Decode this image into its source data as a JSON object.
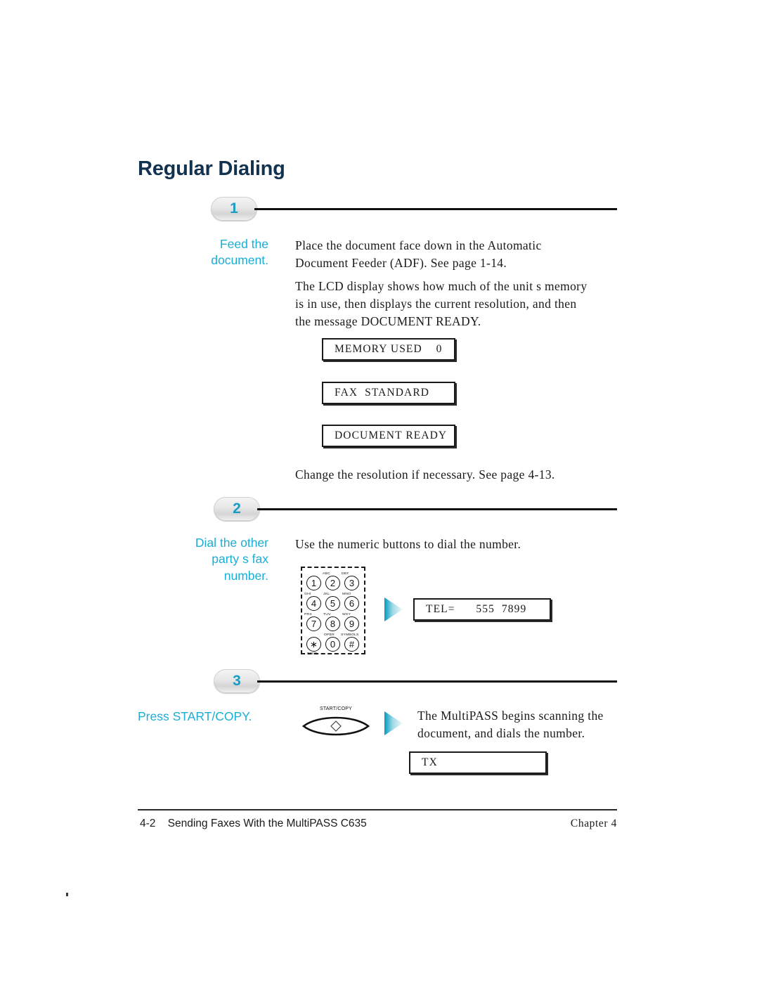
{
  "document": {
    "title": "Regular Dialing"
  },
  "steps": [
    {
      "number": "1",
      "label": "Feed the\ndocument.",
      "paragraphs": [
        "Place the document face down in the Automatic\nDocument Feeder (ADF). See page 1-14.",
        "The LCD display shows how much of the unit s memory\nis in use, then displays the current resolution, and then\nthe message DOCUMENT READY.",
        "Change the resolution if necessary. See page 4-13."
      ],
      "lcd_displays": [
        "MEMORY USED    0",
        "FAX  STANDARD",
        "DOCUMENT READY"
      ]
    },
    {
      "number": "2",
      "label": "Dial the other\nparty s fax\nnumber.",
      "paragraphs": [
        "Use the numeric buttons to dial the number."
      ],
      "lcd_displays": [
        "TEL=      555  7899"
      ],
      "keypad": {
        "keys": [
          {
            "digit": "1",
            "letters": ""
          },
          {
            "digit": "2",
            "letters": "ABC"
          },
          {
            "digit": "3",
            "letters": "DEF"
          },
          {
            "digit": "4",
            "letters": "GHI"
          },
          {
            "digit": "5",
            "letters": "JKL"
          },
          {
            "digit": "6",
            "letters": "MNO"
          },
          {
            "digit": "7",
            "letters": "PRS"
          },
          {
            "digit": "8",
            "letters": "TUV"
          },
          {
            "digit": "9",
            "letters": "WXY"
          },
          {
            "digit": "∗",
            "letters": ""
          },
          {
            "digit": "0",
            "letters": "OPER"
          },
          {
            "digit": "#",
            "letters": "SYMBOLS"
          }
        ],
        "tone_label": "TONE"
      }
    },
    {
      "number": "3",
      "label": "Press START/COPY.",
      "paragraphs": [
        "The MultiPASS begins scanning the\ndocument, and dials the number."
      ],
      "lcd_displays": [
        "TX"
      ],
      "button": {
        "name": "START/COPY"
      }
    }
  ],
  "footer": {
    "page_number": "4-2",
    "title": "Sending Faxes With the MultiPASS C635",
    "chapter": "Chapter 4"
  },
  "colors": {
    "heading": "#12324f",
    "accent_teal": "#1badd4",
    "badge_number": "#1b9cc4",
    "arrow_dark": "#009bbd",
    "rule": "#111111"
  }
}
